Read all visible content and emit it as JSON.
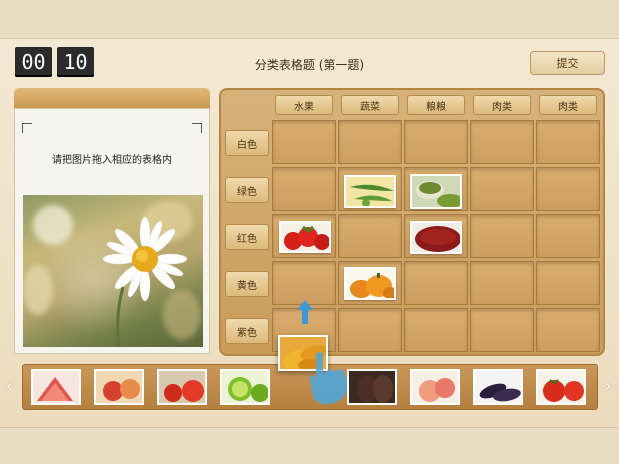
{
  "timer": {
    "minutes": "00",
    "seconds": "10"
  },
  "title": "分类表格题 (第一题)",
  "submit_label": "提交",
  "instruction": "请把图片拖入相应的表格内",
  "columns": [
    "水果",
    "蔬菜",
    "粮粮",
    "肉类",
    "肉类"
  ],
  "rows": [
    "白色",
    "绿色",
    "红色",
    "黄色",
    "紫色"
  ],
  "placed_items": [
    {
      "row": "绿色",
      "column": "蔬菜",
      "item": "okra-image"
    },
    {
      "row": "绿色",
      "column": "粮粮",
      "item": "mung-beans-image"
    },
    {
      "row": "红色",
      "column": "水果",
      "item": "strawberries-image"
    },
    {
      "row": "红色",
      "column": "粮粮",
      "item": "red-beans-image"
    },
    {
      "row": "黄色",
      "column": "蔬菜",
      "item": "pumpkins-image"
    }
  ],
  "tray_items": [
    "grapefruit-image",
    "apples-image",
    "tomato-onion-image",
    "limes-image",
    "eggplant-image",
    "peaches-image",
    "eggplants-image",
    "tomatoes-image"
  ],
  "dragging_item": "mangoes-image",
  "colors": {
    "accent": "#c99c5a",
    "timer_bg": "#2b2b2b",
    "board": "#d6b27a"
  }
}
